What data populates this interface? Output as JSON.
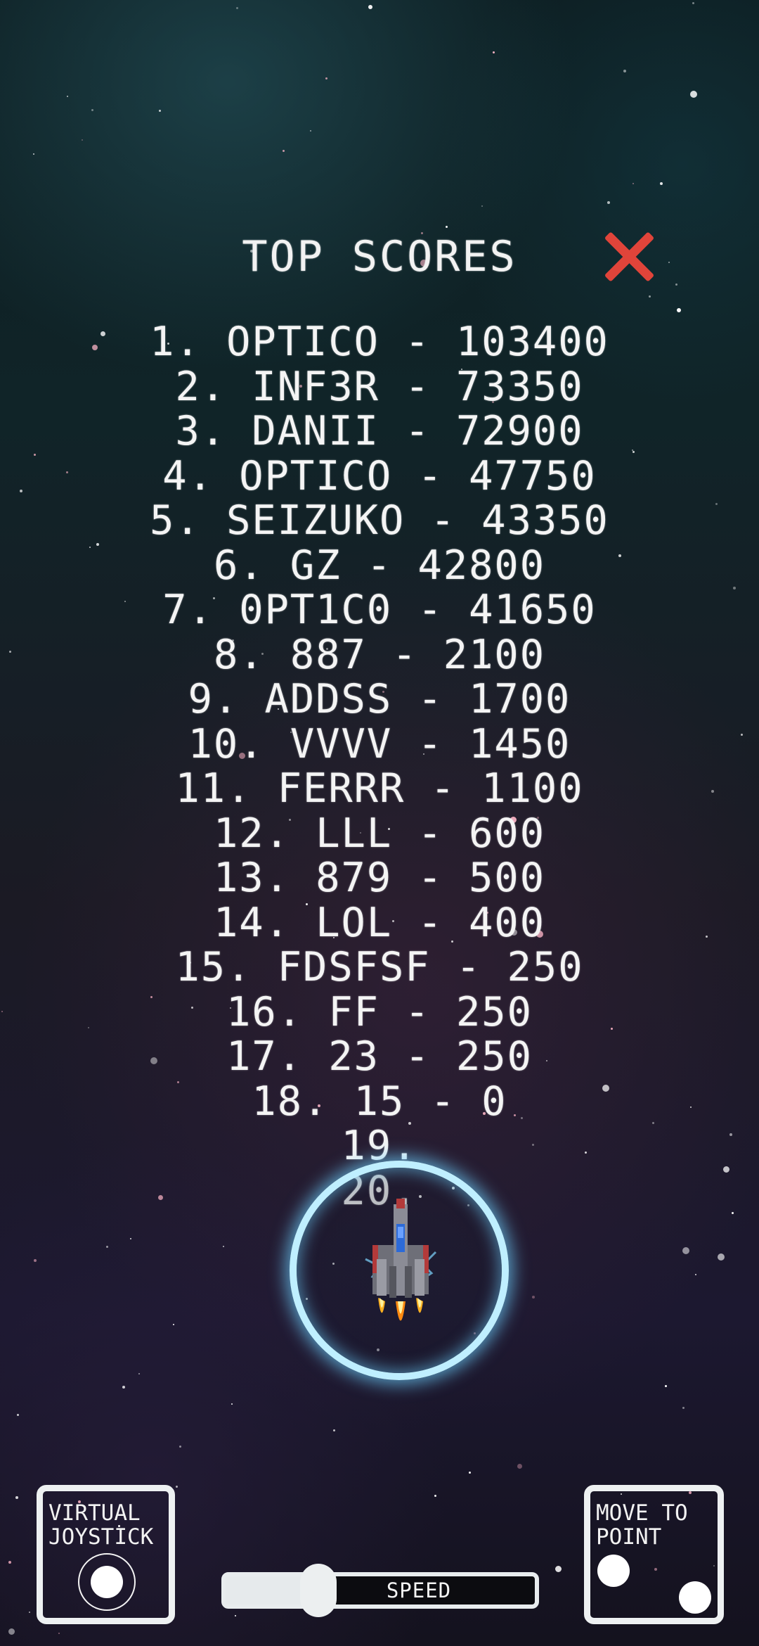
{
  "leaderboard": {
    "title": "TOP SCORES",
    "close_icon": "close-x-icon",
    "close_color": "#e0443a",
    "entries": [
      "1. OPTICO - 103400",
      "2. INF3R - 73350",
      "3. DANII - 72900",
      "4. OPTICO - 47750",
      "5. SEIZUKO - 43350",
      "6. GZ - 42800",
      "7. 0PT1C0 - 41650",
      "8. 887 - 2100",
      "9. ADDSS - 1700",
      "10. VVVV - 1450",
      "11. FERRR - 1100",
      "12. LLL - 600",
      "13. 879 - 500",
      "14. LOL - 400",
      "15. FDSFSF - 250",
      "16. FF - 250",
      "17. 23 - 250",
      "18. 15 - 0",
      "19.",
      "20."
    ]
  },
  "player": {
    "ship_icon": "spaceship-icon",
    "shield_color": "#bfefff"
  },
  "controls": {
    "virtual_joystick_label": "VIRTUAL\nJOYSTICK",
    "move_to_point_label": "MOVE TO\nPOINT",
    "speed_label": "SPEED",
    "speed_level": 0.3
  }
}
